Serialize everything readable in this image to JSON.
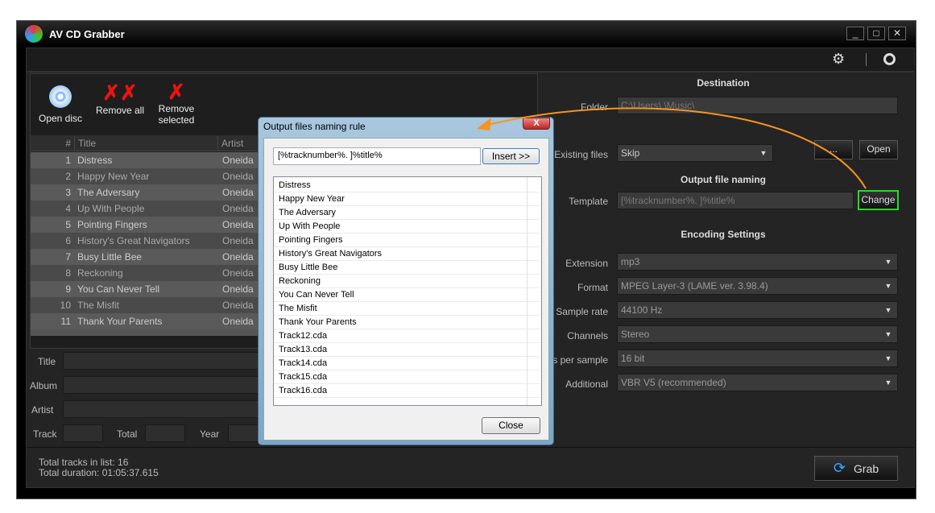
{
  "window": {
    "title": "AV CD Grabber",
    "minimize": "_",
    "maximize": "□",
    "close": "✕"
  },
  "toolbar": {
    "open_disc": "Open disc",
    "remove_all": "Remove all",
    "remove_selected_1": "Remove",
    "remove_selected_2": "selected"
  },
  "list": {
    "headers": {
      "num": "#",
      "title": "Title",
      "artist": "Artist"
    },
    "rows": [
      {
        "n": "1",
        "title": "Distress",
        "artist": "Oneida"
      },
      {
        "n": "2",
        "title": "Happy New Year",
        "artist": "Oneida"
      },
      {
        "n": "3",
        "title": "The Adversary",
        "artist": "Oneida"
      },
      {
        "n": "4",
        "title": "Up With People",
        "artist": "Oneida"
      },
      {
        "n": "5",
        "title": "Pointing Fingers",
        "artist": "Oneida"
      },
      {
        "n": "6",
        "title": "History's Great Navigators",
        "artist": "Oneida"
      },
      {
        "n": "7",
        "title": "Busy Little Bee",
        "artist": "Oneida"
      },
      {
        "n": "8",
        "title": "Reckoning",
        "artist": "Oneida"
      },
      {
        "n": "9",
        "title": "You Can Never Tell",
        "artist": "Oneida"
      },
      {
        "n": "10",
        "title": "The Misfit",
        "artist": "Oneida"
      },
      {
        "n": "11",
        "title": "Thank Your Parents",
        "artist": "Oneida"
      }
    ]
  },
  "tags": {
    "title": "Title",
    "album": "Album",
    "artist": "Artist",
    "track": "Track",
    "total": "Total",
    "year": "Year"
  },
  "status": {
    "tracks": "Total tracks in list: 16",
    "duration": "Total duration: 01:05:37.615"
  },
  "destination": {
    "heading": "Destination",
    "folder_label": "Folder",
    "folder_value": "C:\\Users\\      \\Music\\",
    "browse": "...",
    "open": "Open",
    "existing_label": "Existing files",
    "existing_value": "Skip"
  },
  "naming": {
    "heading": "Output file naming",
    "template_label": "Template",
    "template_value": "[%tracknumber%. ]%title%",
    "change": "Change"
  },
  "encoding": {
    "heading": "Encoding Settings",
    "rows": [
      {
        "label": "Extension",
        "value": "mp3"
      },
      {
        "label": "Format",
        "value": "MPEG Layer-3 (LAME ver. 3.98.4)"
      },
      {
        "label": "Sample rate",
        "value": "44100 Hz"
      },
      {
        "label": "Channels",
        "value": "Stereo"
      },
      {
        "label": "Bits per sample",
        "value": "16 bit"
      },
      {
        "label": "Additional",
        "value": "VBR V5 (recommended)"
      }
    ]
  },
  "grab": "Grab",
  "dialog": {
    "title": "Output files naming rule",
    "template": "[%tracknumber%. ]%title%",
    "insert": "Insert >>",
    "close": "Close",
    "close_x": "X",
    "items": [
      "Distress",
      "Happy New Year",
      "The Adversary",
      "Up With People",
      "Pointing Fingers",
      "History's Great Navigators",
      "Busy Little Bee",
      "Reckoning",
      "You Can Never Tell",
      "The Misfit",
      "Thank Your Parents",
      "Track12.cda",
      "Track13.cda",
      "Track14.cda",
      "Track15.cda",
      "Track16.cda"
    ]
  },
  "colors": {
    "highlight": "#22dd22",
    "arrow": "#f7931e"
  }
}
